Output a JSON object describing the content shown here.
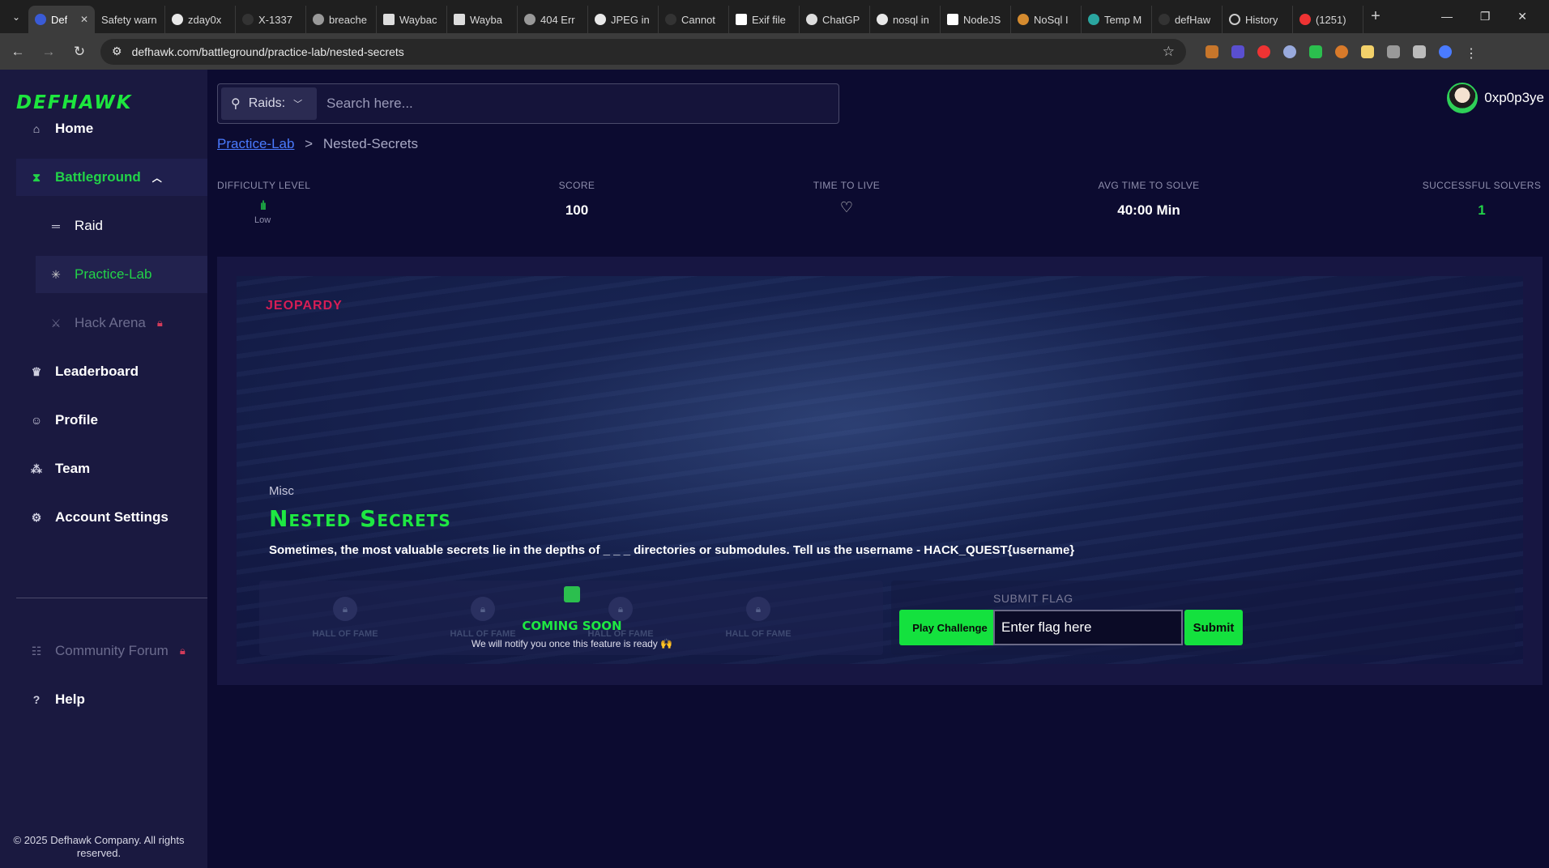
{
  "browser": {
    "tabs": [
      {
        "title": "Def",
        "active": true
      },
      {
        "title": "Safety warn"
      },
      {
        "title": "zday0x"
      },
      {
        "title": "X-1337"
      },
      {
        "title": "breache"
      },
      {
        "title": "Waybac"
      },
      {
        "title": "Wayba"
      },
      {
        "title": "404 Err"
      },
      {
        "title": "JPEG in"
      },
      {
        "title": "Cannot"
      },
      {
        "title": "Exif file"
      },
      {
        "title": "ChatGP"
      },
      {
        "title": "nosql in"
      },
      {
        "title": "NodeJS"
      },
      {
        "title": "NoSql I"
      },
      {
        "title": "Temp M"
      },
      {
        "title": "defHaw"
      },
      {
        "title": "History"
      },
      {
        "title": "(1251)"
      }
    ],
    "url": "defhawk.com/battleground/practice-lab/nested-secrets"
  },
  "sidebar": {
    "logo": "DEFHAWK",
    "items": {
      "home": "Home",
      "battleground": "Battleground",
      "raid": "Raid",
      "practice_lab": "Practice-Lab",
      "hack_arena": "Hack Arena",
      "leaderboard": "Leaderboard",
      "profile": "Profile",
      "team": "Team",
      "account_settings": "Account Settings",
      "community_forum": "Community Forum",
      "help": "Help"
    },
    "copyright": "© 2025 Defhawk Company. All rights reserved."
  },
  "header": {
    "raids_label": "Raids:",
    "search_placeholder": "Search here...",
    "username": "0xp0p3ye"
  },
  "breadcrumb": {
    "parent": "Practice-Lab",
    "separator": ">",
    "current": "Nested-Secrets"
  },
  "stats": {
    "difficulty_label": "DIFFICULTY LEVEL",
    "difficulty_value": "Low",
    "score_label": "SCORE",
    "score_value": "100",
    "ttl_label": "TIME TO LIVE",
    "avg_label": "AVG TIME TO SOLVE",
    "avg_value": "40:00 Min",
    "solvers_label": "SUCCESSFUL SOLVERS",
    "solvers_value": "1"
  },
  "challenge": {
    "type": "JEOPARDY",
    "category": "Misc",
    "title": "Nested Secrets",
    "description": "Sometimes, the most valuable secrets lie in the depths of _ _ _ directories or submodules. Tell us the username - HACK_QUEST{username}",
    "hall_of_fame": [
      "HALL OF FAME",
      "HALL OF FAME",
      "HALL OF FAME",
      "HALL OF FAME"
    ],
    "coming_soon": "COMING SOON",
    "notify": "We will notify you once this feature is ready 🙌",
    "play_label": "Play Challenge",
    "submit_flag_label": "SUBMIT FLAG",
    "flag_placeholder": "Enter flag here",
    "submit_label": "Submit"
  },
  "colors": {
    "accent_green": "#14e13e",
    "jeopardy_red": "#d61d55",
    "link_blue": "#4a7bff"
  }
}
